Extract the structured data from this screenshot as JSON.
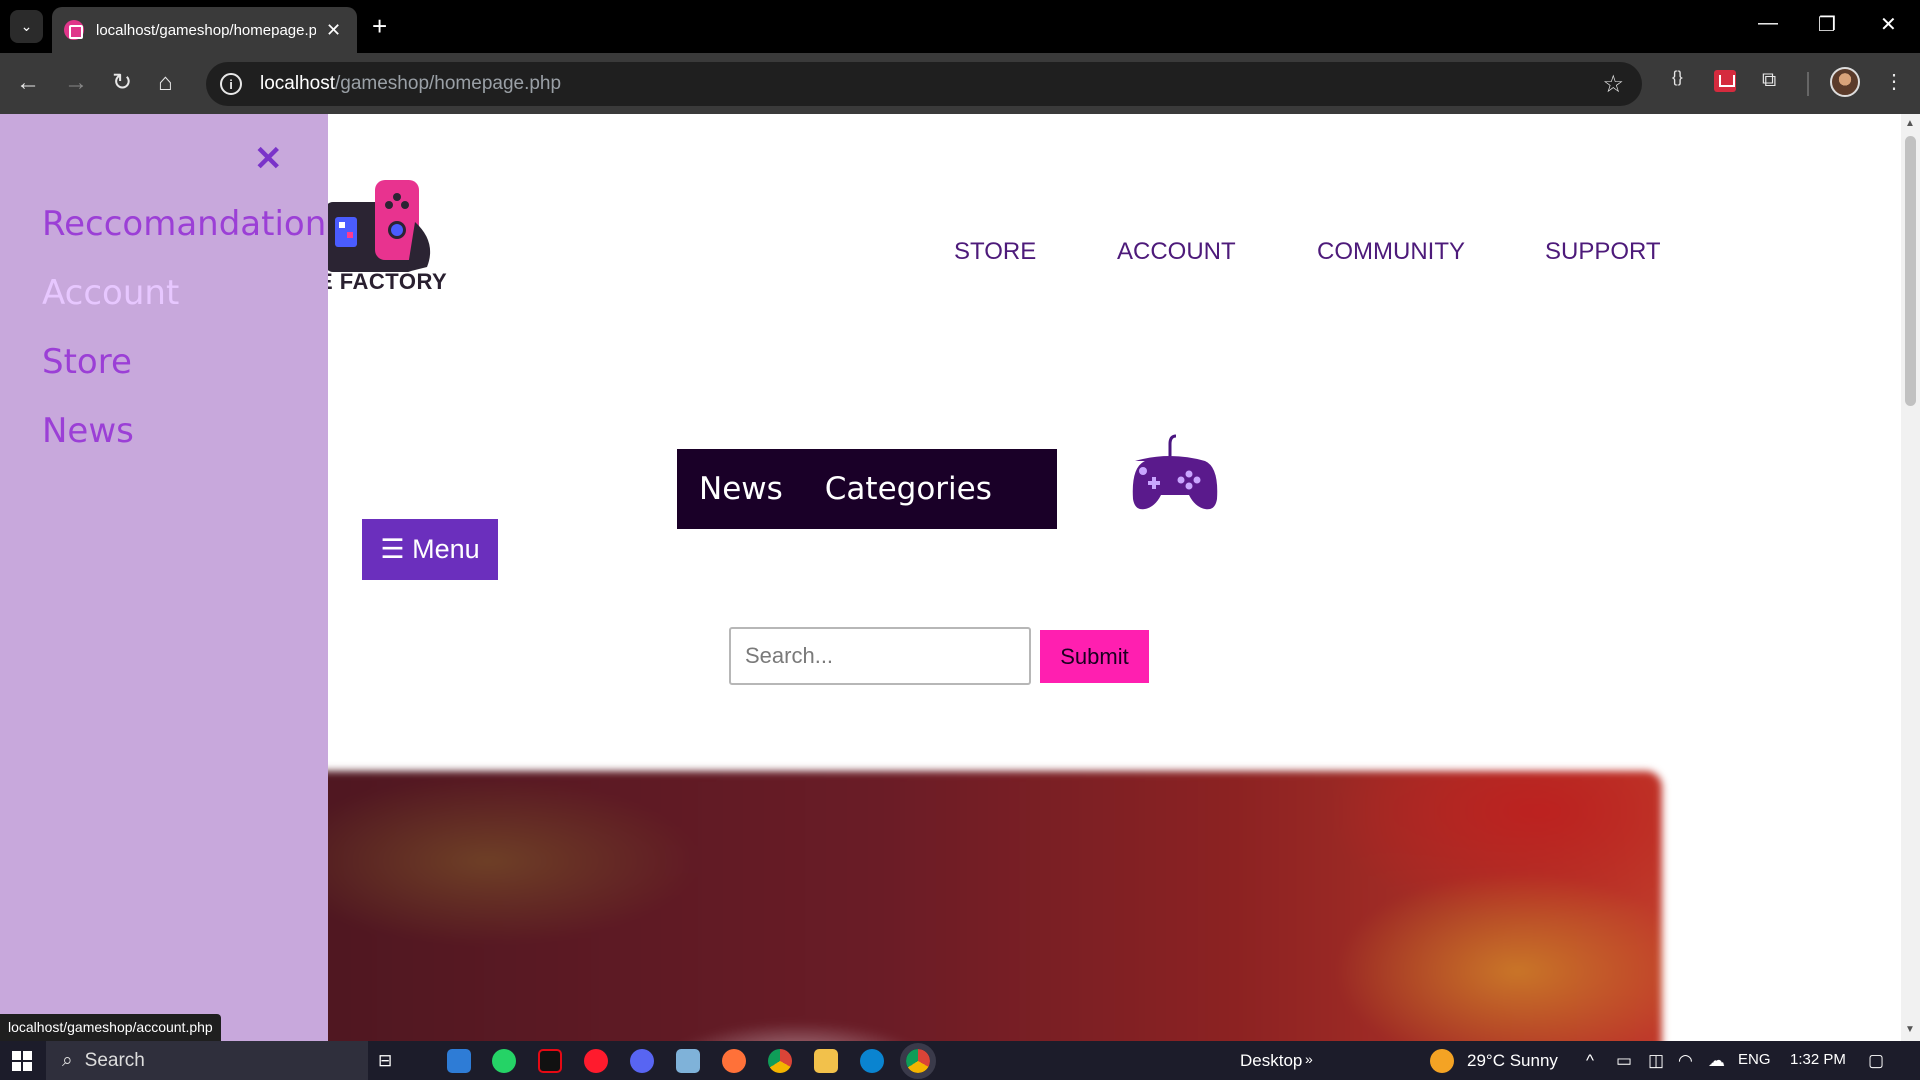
{
  "browser": {
    "tab_title": "localhost/gameshop/homepage.php",
    "url_host": "localhost",
    "url_path": "/gameshop/homepage.php"
  },
  "site": {
    "logo_text": "E FACTORY",
    "nav": [
      "STORE",
      "ACCOUNT",
      "COMMUNITY",
      "SUPPORT"
    ],
    "news_bar": [
      "News",
      "Categories"
    ],
    "menu_button": "☰ Menu",
    "search_placeholder": "Search...",
    "submit_label": "Submit"
  },
  "drawer": {
    "close_symbol": "✕",
    "links": [
      {
        "label": "Reccomandation",
        "color": "#9b3fd6"
      },
      {
        "label": "Account",
        "color": "#e7c7ff"
      },
      {
        "label": "Store",
        "color": "#9b3fd6"
      },
      {
        "label": "News",
        "color": "#9b3fd6"
      }
    ]
  },
  "status_url": "localhost/gameshop/account.php",
  "taskbar": {
    "search_label": "Search",
    "desktop_label": "Desktop",
    "weather": "29°C  Sunny",
    "lang": "ENG",
    "time": "1:32 PM"
  },
  "colors": {
    "brand_purple": "#6b2fbd",
    "accent_pink": "#ff1fb0",
    "drawer_bg": "#c8a8dc",
    "nav_text": "#4d1a7a"
  }
}
